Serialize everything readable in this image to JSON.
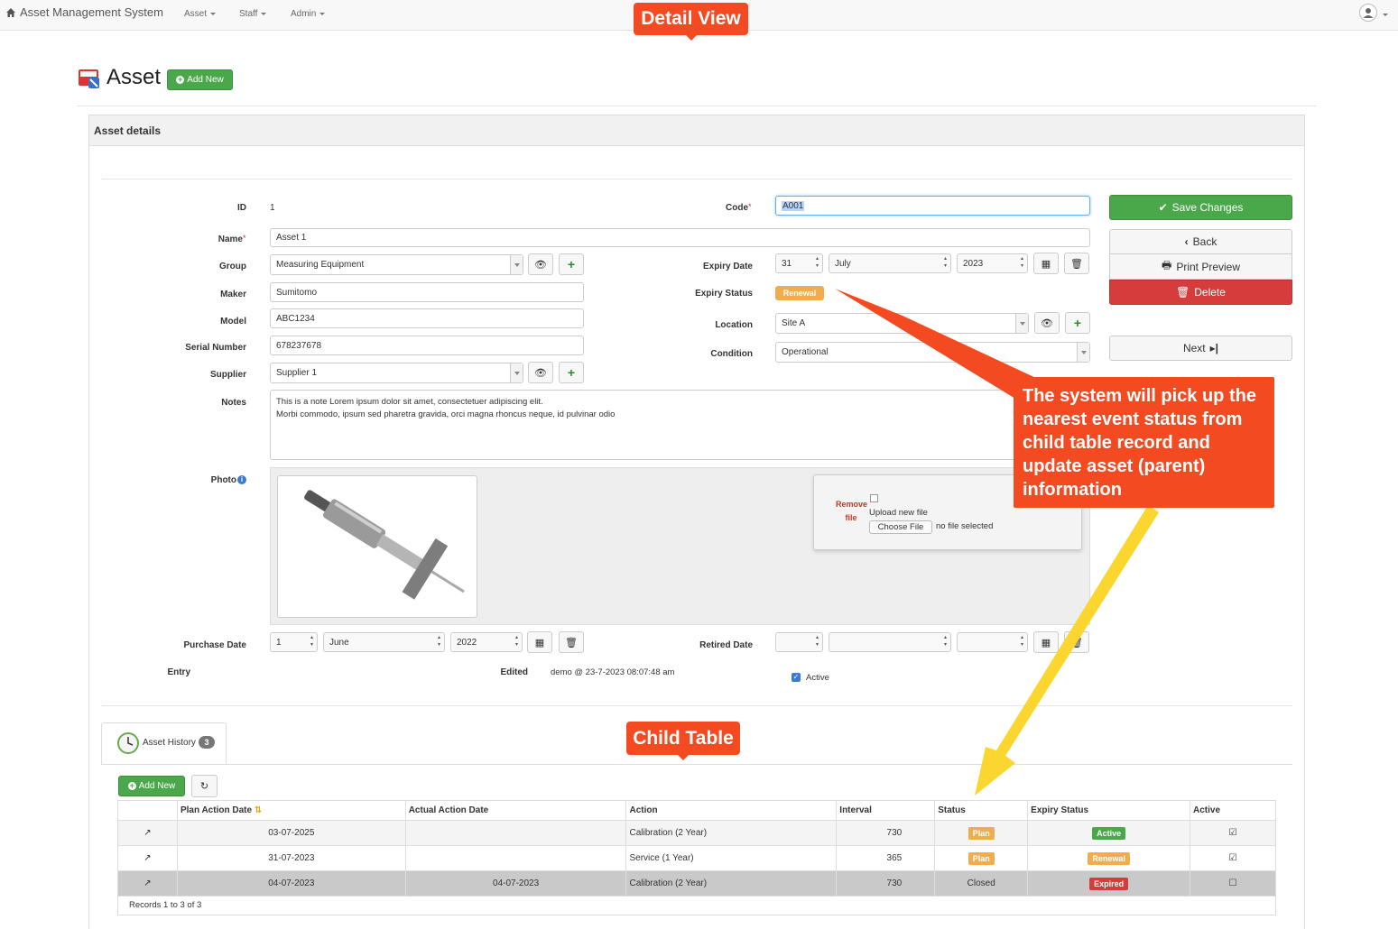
{
  "navbar": {
    "brand": "Asset Management System",
    "menu": [
      "Asset",
      "Staff",
      "Admin"
    ]
  },
  "callouts": {
    "detail_view": "Detail View",
    "child_table": "Child Table",
    "note": "The system will pick up the nearest event status from child table record and update asset (parent) information"
  },
  "page": {
    "title": "Asset",
    "add_new": "Add New"
  },
  "panel": {
    "heading": "Asset details"
  },
  "form": {
    "id_label": "ID",
    "id_value": "1",
    "code_label": "Code",
    "code_value": "A001",
    "name_label": "Name",
    "name_value": "Asset 1",
    "group_label": "Group",
    "group_value": "Measuring Equipment",
    "maker_label": "Maker",
    "maker_value": "Sumitomo",
    "model_label": "Model",
    "model_value": "ABC1234",
    "serial_label": "Serial Number",
    "serial_value": "678237678",
    "supplier_label": "Supplier",
    "supplier_value": "Supplier 1",
    "notes_label": "Notes",
    "notes_line1": "This is a note Lorem ipsum dolor sit amet, consectetuer adipiscing elit.",
    "notes_line2": "Morbi commodo, ipsum sed pharetra gravida, orci magna rhoncus neque, id pulvinar odio",
    "photo_label": "Photo",
    "remove_file": "Remove file",
    "upload_new_file": "Upload new file",
    "choose_file": "Choose File",
    "no_file": "no file selected",
    "expiry_date_label": "Expiry Date",
    "expiry_day": "31",
    "expiry_month": "July",
    "expiry_year": "2023",
    "expiry_status_label": "Expiry Status",
    "expiry_status_value": "Renewal",
    "location_label": "Location",
    "location_value": "Site A",
    "condition_label": "Condition",
    "condition_value": "Operational",
    "purchase_date_label": "Purchase Date",
    "purchase_day": "1",
    "purchase_month": "June",
    "purchase_year": "2022",
    "retired_date_label": "Retired Date",
    "entry_label": "Entry",
    "edited_label": "Edited",
    "edited_value": "demo @ 23-7-2023 08:07:48 am",
    "active_label": "Active"
  },
  "actions": {
    "save": "Save Changes",
    "back": "Back",
    "print": "Print Preview",
    "delete": "Delete",
    "next": "Next"
  },
  "child": {
    "tab_label": "Asset History",
    "tab_count": "3",
    "add_new": "Add New",
    "columns": [
      "",
      "Plan Action Date",
      "Actual Action Date",
      "Action",
      "Interval",
      "Status",
      "Expiry Status",
      "Active"
    ],
    "rows": [
      {
        "plan": "03-07-2025",
        "actual": "",
        "action": "Calibration (2 Year)",
        "interval": "730",
        "status": "Plan",
        "expiry": "Active",
        "active": "☑"
      },
      {
        "plan": "31-07-2023",
        "actual": "",
        "action": "Service (1 Year)",
        "interval": "365",
        "status": "Plan",
        "expiry": "Renewal",
        "active": "☑"
      },
      {
        "plan": "04-07-2023",
        "actual": "04-07-2023",
        "action": "Calibration (2 Year)",
        "interval": "730",
        "status": "Closed",
        "expiry": "Expired",
        "active": "☐"
      }
    ],
    "footer": "Records 1 to 3 of 3"
  },
  "colors": {
    "callout": "#f44a22",
    "green": "#4aa84a",
    "red": "#d63c3c",
    "orange": "#f0ad4e",
    "arrow_yellow": "#fbd62e"
  }
}
